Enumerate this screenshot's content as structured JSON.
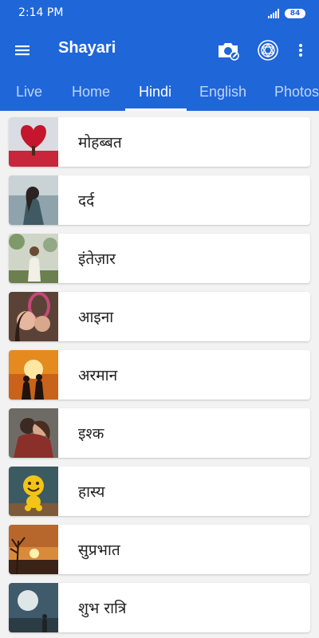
{
  "status": {
    "time": "2:14 PM",
    "battery": "84"
  },
  "appbar": {
    "title": "Shayari",
    "icons": [
      "menu-icon",
      "camera-icon",
      "chakra-icon",
      "more-vert-icon"
    ]
  },
  "tabs": [
    {
      "label": "Live",
      "active": false
    },
    {
      "label": "Home",
      "active": false
    },
    {
      "label": "Hindi",
      "active": true
    },
    {
      "label": "English",
      "active": false
    },
    {
      "label": "Photos",
      "active": false
    }
  ],
  "categories": [
    {
      "label": "मोहब्बत",
      "image": "red-heart-tree-image"
    },
    {
      "label": "दर्द",
      "image": "sad-girl-image"
    },
    {
      "label": "इंतेज़ार",
      "image": "waiting-girl-image"
    },
    {
      "label": "आइना",
      "image": "mirror-couple-image"
    },
    {
      "label": "अरमान",
      "image": "sunset-couple-image"
    },
    {
      "label": "इश्क",
      "image": "hugging-couple-image"
    },
    {
      "label": "हास्य",
      "image": "smiley-toy-image"
    },
    {
      "label": "सुप्रभात",
      "image": "sunrise-image"
    },
    {
      "label": "शुभ रात्रि",
      "image": "moon-night-image"
    }
  ],
  "colors": {
    "primary": "#1f66d9",
    "background": "#f2f2f2",
    "card": "#ffffff"
  }
}
